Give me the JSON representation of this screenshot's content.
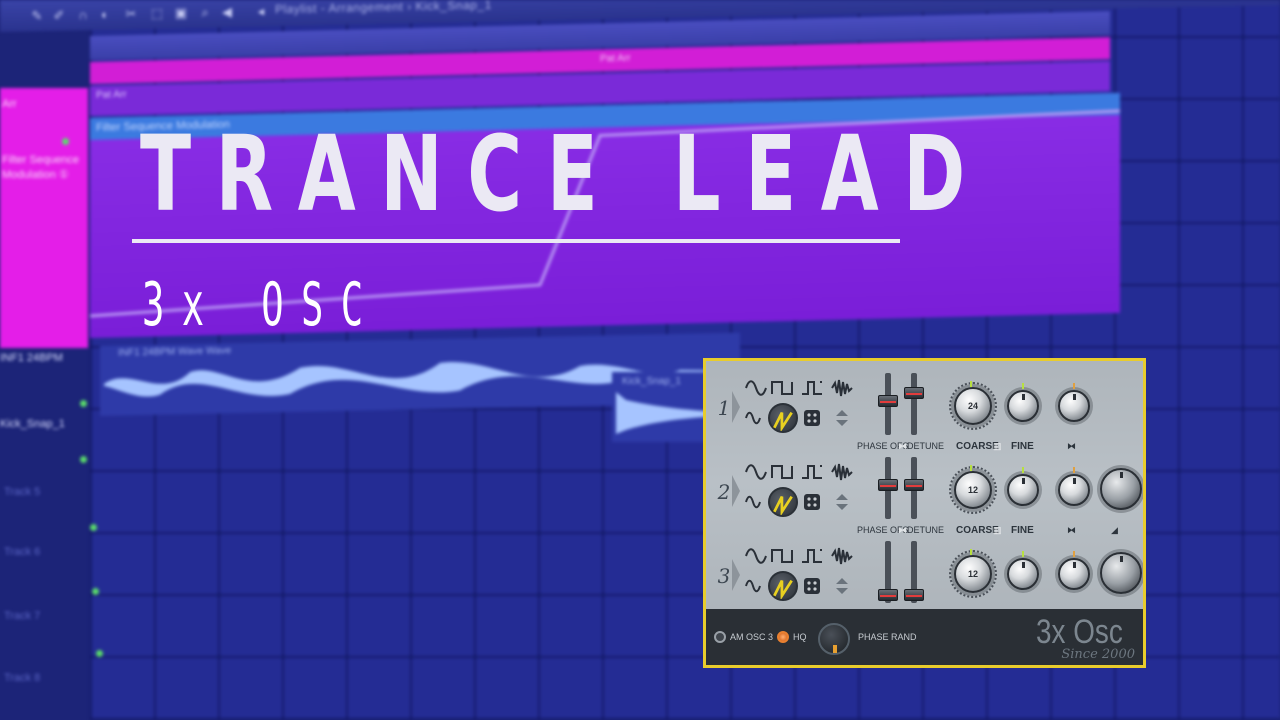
{
  "daw": {
    "window_title": "Playlist - Arrangement › Kick_Snap_1",
    "pattern_name": "Pat Arr",
    "pattern_clip": "Pat Arr",
    "automation_clip": "Filter Sequence Modulation",
    "sidebar_text": [
      "Arr",
      "Filter Sequence",
      "Modulation ①"
    ],
    "audio_track_label": "INF1 24BPM",
    "audio_clip_label": "INF1 24BPM Wave Wave",
    "kick_track_label": "Kick_Snap_1",
    "kick_clip_label": "Kick_Snap_1",
    "empty_tracks": [
      "Track 5",
      "Track 6",
      "Track 7",
      "Track 8"
    ]
  },
  "title": "TRANCE LEAD",
  "subtitle": "3x OSC",
  "plugin": {
    "name": "3x Osc",
    "tagline": "Since 2000",
    "phase_label": "PHASE OFS",
    "detune_label": "DETUNE",
    "coarse_label": "COARSE",
    "fine_label": "FINE",
    "oscillators": [
      {
        "number": "1",
        "coarse": "24",
        "show_labels": true,
        "has_vol_knob": false
      },
      {
        "number": "2",
        "coarse": "12",
        "show_labels": true,
        "has_vol_knob": true
      },
      {
        "number": "3",
        "coarse": "12",
        "show_labels": false,
        "has_vol_knob": true
      }
    ],
    "bottom": {
      "am_label": "AM OSC 3",
      "hq_label": "HQ",
      "phase_rand_label": "PHASE RAND",
      "hq_on": true,
      "am_on": false
    }
  }
}
